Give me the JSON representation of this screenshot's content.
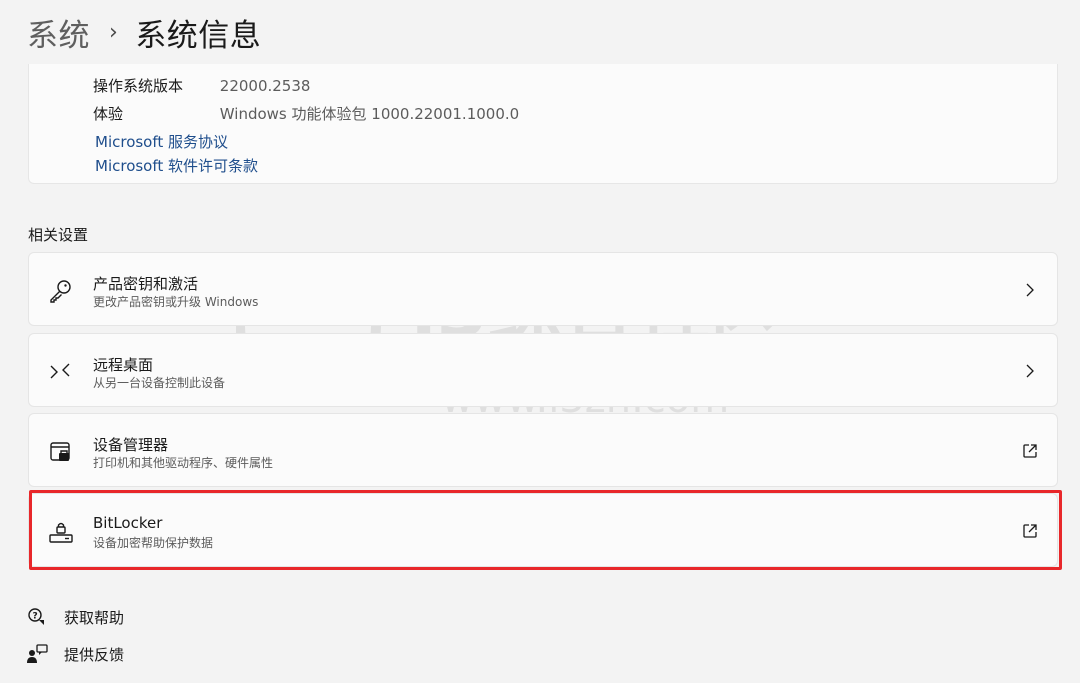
{
  "breadcrumb": {
    "parent": "系统",
    "separator": "›",
    "current": "系统信息"
  },
  "os_info": {
    "version_label": "操作系统版本",
    "version_value": "22000.2538",
    "experience_label": "体验",
    "experience_value": "Windows 功能体验包 1000.22001.1000.0",
    "links": [
      "Microsoft 服务协议",
      "Microsoft 软件许可条款"
    ]
  },
  "related": {
    "title": "相关设置",
    "items": [
      {
        "title": "产品密钥和激活",
        "subtitle": "更改产品密钥或升级 Windows",
        "icon": "key-icon",
        "trail": "chevron-right-icon"
      },
      {
        "title": "远程桌面",
        "subtitle": "从另一台设备控制此设备",
        "icon": "remote-desktop-icon",
        "trail": "chevron-right-icon"
      },
      {
        "title": "设备管理器",
        "subtitle": "打印机和其他驱动程序、硬件属性",
        "icon": "device-manager-icon",
        "trail": "open-external-icon"
      },
      {
        "title": "BitLocker",
        "subtitle": "设备加密帮助保护数据",
        "icon": "bitlocker-icon",
        "trail": "open-external-icon"
      }
    ]
  },
  "footer": {
    "help": "获取帮助",
    "feedback": "提供反馈"
  },
  "watermark": {
    "title": "i3综合社区",
    "url": "www.i3zh.com"
  },
  "colors": {
    "highlight": "#e8272a",
    "link": "#1f4e8c"
  }
}
